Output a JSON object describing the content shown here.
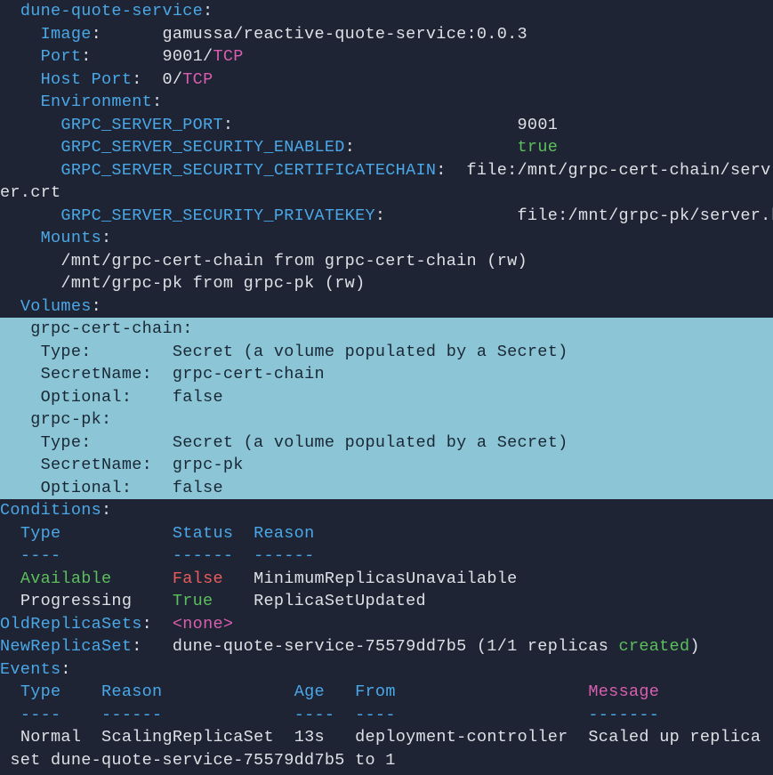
{
  "service": {
    "name": "dune-quote-service",
    "colon": ":",
    "image_label": "Image",
    "image_value": "gamussa/reactive-quote-service:0.0.3",
    "port_label": "Port",
    "port_value": "9001",
    "host_port_label": "Host Port",
    "host_port_value": "0",
    "tcp": "TCP",
    "slash": "/",
    "env_label": "Environment",
    "env": {
      "k1": "GRPC_SERVER_PORT",
      "v1": "9001",
      "k2": "GRPC_SERVER_SECURITY_ENABLED",
      "v2": "true",
      "k3": "GRPC_SERVER_SECURITY_CERTIFICATECHAIN",
      "v3a": "file:/mnt/grpc-cert-chain/serv",
      "v3b": "er.crt",
      "k4": "GRPC_SERVER_SECURITY_PRIVATEKEY",
      "v4": "file:/mnt/grpc-pk/server.key"
    },
    "mounts_label": "Mounts",
    "mount1": "/mnt/grpc-cert-chain from grpc-cert-chain (rw)",
    "mount2": "/mnt/grpc-pk from grpc-pk (rw)"
  },
  "volumes": {
    "label": "Volumes",
    "v1_name": "grpc-cert-chain",
    "type_label": "Type",
    "type_value": "Secret (a volume populated by a Secret)",
    "secretname_label": "SecretName",
    "v1_secretname": "grpc-cert-chain",
    "optional_label": "Optional",
    "optional_value": "false",
    "v2_name": "grpc-pk",
    "v2_secretname": "grpc-pk"
  },
  "conditions": {
    "label": "Conditions",
    "h_type": "Type",
    "h_status": "Status",
    "h_reason": "Reason",
    "dash_type": "----",
    "dash_status": "------",
    "dash_reason": "------",
    "r1_type": "Available",
    "r1_status": "False",
    "r1_reason": "MinimumReplicasUnavailable",
    "r2_type": "Progressing",
    "r2_status": "True",
    "r2_reason": "ReplicaSetUpdated"
  },
  "replicasets": {
    "old_label": "OldReplicaSets",
    "old_value": "<none>",
    "new_label": "NewReplicaSet",
    "new_value_pre": "dune-quote-service-75579dd7b5 (1/1 replicas ",
    "new_value_created": "created",
    "new_value_post": ")"
  },
  "events": {
    "label": "Events",
    "h_type": "Type",
    "h_reason": "Reason",
    "h_age": "Age",
    "h_from": "From",
    "h_message": "Message",
    "dash_type": "----",
    "dash_reason": "------",
    "dash_age": "----",
    "dash_from": "----",
    "dash_message": "-------",
    "r1_type": "Normal",
    "r1_reason": "ScalingReplicaSet",
    "r1_age": "13s",
    "r1_from": "deployment-controller",
    "r1_msg": "Scaled up replica",
    "r1_msg2": " set dune-quote-service-75579dd7b5 to 1"
  }
}
